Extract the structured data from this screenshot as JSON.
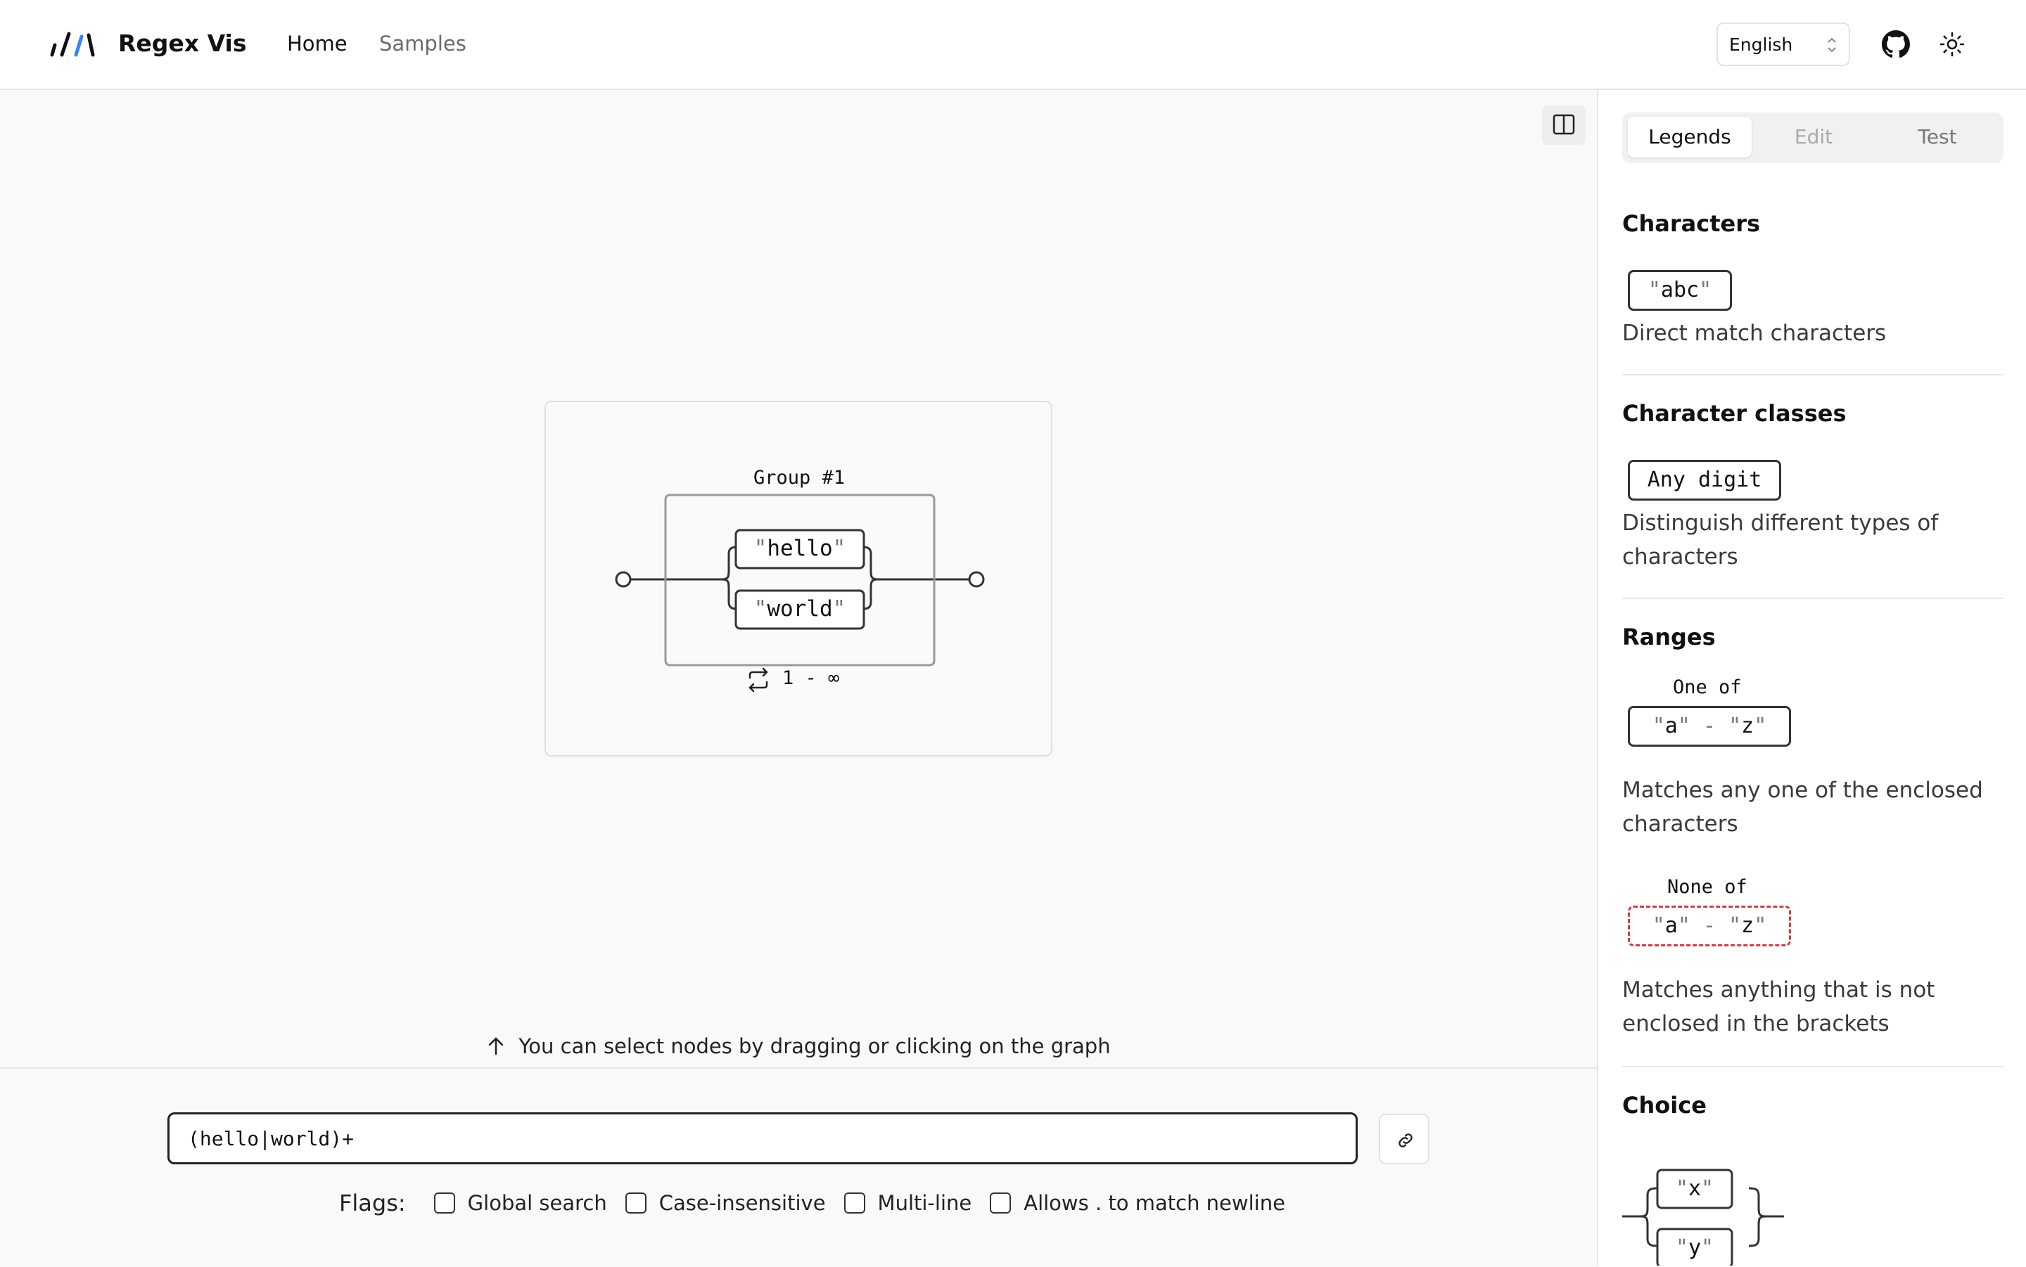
{
  "header": {
    "brand": "Regex Vis",
    "nav": {
      "home": "Home",
      "samples": "Samples"
    },
    "language": "English"
  },
  "graph": {
    "group_label": "Group #1",
    "alternatives": [
      "hello",
      "world"
    ],
    "quantifier": "1 - ∞"
  },
  "hint": "You can select nodes by dragging or clicking on the graph",
  "editor": {
    "regex": "(hello|world)+",
    "flags_label": "Flags:",
    "flags": [
      {
        "label": "Global search",
        "checked": false
      },
      {
        "label": "Case-insensitive",
        "checked": false
      },
      {
        "label": "Multi-line",
        "checked": false
      },
      {
        "label": "Allows . to match newline",
        "checked": false
      }
    ]
  },
  "sidebar": {
    "tabs": [
      "Legends",
      "Edit",
      "Test"
    ],
    "active_tab": "Legends",
    "sections": {
      "characters": {
        "title": "Characters",
        "example": "abc",
        "desc": "Direct match characters"
      },
      "classes": {
        "title": "Character classes",
        "example": "Any digit",
        "desc": "Distinguish different types of characters"
      },
      "ranges": {
        "title": "Ranges",
        "one_of_label": "One of",
        "from": "a",
        "to": "z",
        "one_of_desc": "Matches any one of the enclosed characters",
        "none_of_label": "None of",
        "none_of_desc": "Matches anything that is not enclosed in the brackets"
      },
      "choice": {
        "title": "Choice",
        "options": [
          "x",
          "y"
        ]
      }
    }
  },
  "colors": {
    "accent_blue": "#3b82f6",
    "negate_red": "#d9363e"
  }
}
